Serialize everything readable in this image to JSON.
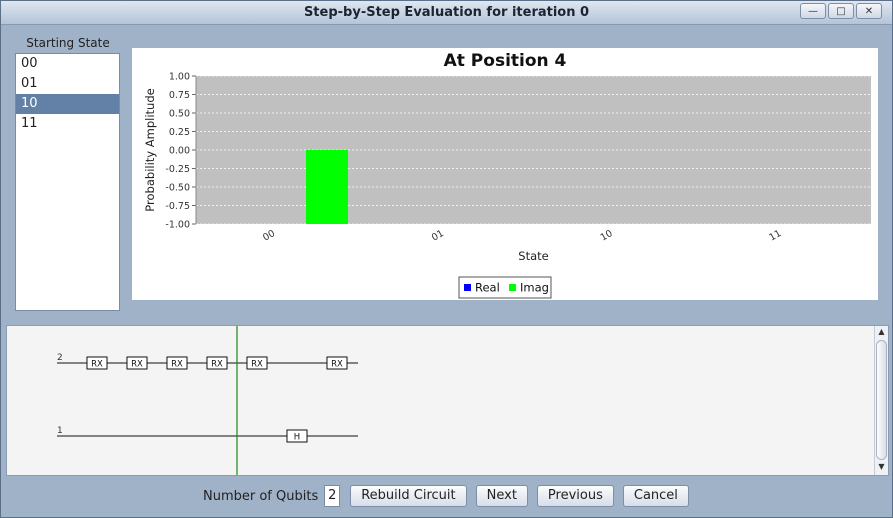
{
  "window": {
    "title": "Step-by-Step Evaluation for iteration 0",
    "controls": [
      "minimize-icon",
      "restore-icon",
      "close-icon"
    ]
  },
  "starting_state": {
    "label": "Starting State",
    "items": [
      "00",
      "01",
      "10",
      "11"
    ],
    "selected": "10"
  },
  "chart_data": {
    "type": "bar",
    "title": "At Position 4",
    "xlabel": "State",
    "ylabel": "Probability Amplitude",
    "categories": [
      "00",
      "01",
      "10",
      "11"
    ],
    "series": [
      {
        "name": "Real",
        "color": "#0000ff",
        "values": [
          0,
          0,
          0,
          0
        ]
      },
      {
        "name": "Imag",
        "color": "#00ff00",
        "values": [
          -1.0,
          0,
          0,
          0
        ]
      }
    ],
    "yticks": [
      "1.00",
      "0.75",
      "0.50",
      "0.25",
      "0.00",
      "-0.25",
      "-0.50",
      "-0.75",
      "-1.00"
    ],
    "ylim": [
      -1.0,
      1.0
    ],
    "grid": true,
    "legend": "bottom"
  },
  "circuit": {
    "qubit_labels": [
      "2",
      "1"
    ],
    "gates_q2": [
      "RX",
      "RX",
      "RX",
      "RX",
      "RX",
      "RX"
    ],
    "gates_q1": [
      "H"
    ],
    "cursor_position": 4
  },
  "footer": {
    "qubits_label": "Number of Qubits",
    "qubits_value": "2",
    "rebuild": "Rebuild Circuit",
    "next": "Next",
    "previous": "Previous",
    "cancel": "Cancel"
  }
}
